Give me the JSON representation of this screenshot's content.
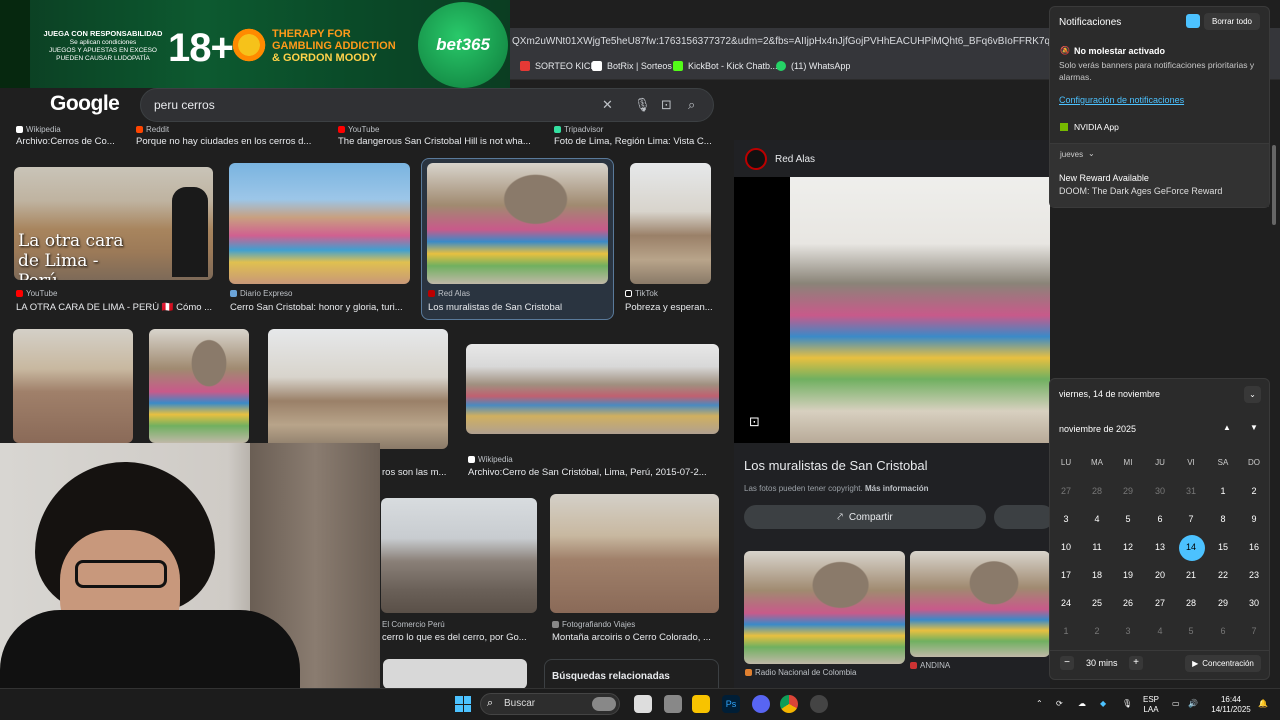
{
  "browser": {
    "url": "QXm2uWNt01XWjgTe5heU87fw:1763156377372&udm=2&fbs=AIIjpHx4nJjfGojPVHhEACUHPiMQht6_BFq6vBIoFFRK7qchKHDX9Tp",
    "bookmarks": [
      {
        "label": "SORTEO KICK"
      },
      {
        "label": "BotRix | Sorteos"
      },
      {
        "label": "KickBot - Kick Chatb..."
      },
      {
        "label": "(11) WhatsApp"
      }
    ]
  },
  "ad": {
    "responsibility_title": "JUEGA CON RESPONSABILIDAD",
    "responsibility_lines": [
      "Se aplican condiciones",
      "JUEGOS Y APUESTAS EN EXCESO",
      "PUEDEN CAUSAR LUDOPATÍA"
    ],
    "age": "18+",
    "therapy": "THERAPY FOR GAMBLING ADDICTION",
    "gordon": "& GORDON MOODY",
    "brand": "bet365"
  },
  "google": {
    "logo": "Google",
    "query": "peru cerros"
  },
  "results": {
    "row0": [
      {
        "source": "Wikipedia",
        "caption": "Archivo:Cerros de Co..."
      },
      {
        "source": "Reddit",
        "caption": "Porque no hay ciudades en los cerros d..."
      },
      {
        "source": "YouTube",
        "caption": "The dangerous San Cristobal Hill is not wha..."
      },
      {
        "source": "Tripadvisor",
        "caption": "Foto de Lima, Región Lima: Vista C..."
      }
    ],
    "row1": [
      {
        "source": "YouTube",
        "caption": "LA OTRA CARA DE LIMA - PERÚ 🇵🇪 Cómo ...",
        "overlay": "La otra cara de Lima - Perú"
      },
      {
        "source": "Diario Expreso",
        "caption": "Cerro San Cristobal: honor y gloria, turi..."
      },
      {
        "source": "Red Alas",
        "caption": "Los muralistas de San Cristobal"
      },
      {
        "source": "TikTok",
        "caption": "Pobreza y esperan..."
      }
    ],
    "row2": [
      {
        "source": "",
        "caption": "ros son las m..."
      },
      {
        "source": "Wikipedia",
        "caption": "Archivo:Cerro de San Cristóbal, Lima, Perú, 2015-07-2..."
      }
    ],
    "row3": [
      {
        "source": "El Comercio Perú",
        "caption": "cerro lo que es del cerro, por Go..."
      },
      {
        "source": "Fotografiando Viajes",
        "caption": "Montaña arcoiris o Cerro Colorado, ..."
      }
    ],
    "related": "Búsquedas relacionadas"
  },
  "panel": {
    "source": "Red Alas",
    "title": "Los muralistas de San Cristobal",
    "copyright": "Las fotos pueden tener copyright.",
    "more_info": "Más información",
    "share": "Compartir",
    "related_sources": [
      "Radio Nacional de Colombia",
      "ANDINA"
    ]
  },
  "notifications": {
    "title": "Notificaciones",
    "clear_all": "Borrar todo",
    "dnd_title": "No molestar activado",
    "dnd_body": "Solo verás banners para notificaciones prioritarias y alarmas.",
    "settings_link": "Configuración de notificaciones",
    "app": "NVIDIA App",
    "group": "jueves",
    "item_title": "New Reward Available",
    "item_body": "DOOM: The Dark Ages GeForce Reward"
  },
  "calendar": {
    "date_header": "viernes, 14 de noviembre",
    "month": "noviembre de 2025",
    "weekdays": [
      "LU",
      "MA",
      "MI",
      "JU",
      "VI",
      "SA",
      "DO"
    ],
    "weeks": [
      [
        "27",
        "28",
        "29",
        "30",
        "31",
        "1",
        "2"
      ],
      [
        "3",
        "4",
        "5",
        "6",
        "7",
        "8",
        "9"
      ],
      [
        "10",
        "11",
        "12",
        "13",
        "14",
        "15",
        "16"
      ],
      [
        "17",
        "18",
        "19",
        "20",
        "21",
        "22",
        "23"
      ],
      [
        "24",
        "25",
        "26",
        "27",
        "28",
        "29",
        "30"
      ],
      [
        "1",
        "2",
        "3",
        "4",
        "5",
        "6",
        "7"
      ]
    ],
    "today": "14",
    "focus_duration": "30 mins",
    "focus_label": "Concentración"
  },
  "taskbar": {
    "search_placeholder": "Buscar",
    "lang1": "ESP",
    "lang2": "LAA",
    "time": "16:44",
    "date": "14/11/2025"
  },
  "colors": {
    "accent": "#4cc2ff",
    "bg": "#1f1f1f",
    "ad_green": "#0d5a30"
  }
}
